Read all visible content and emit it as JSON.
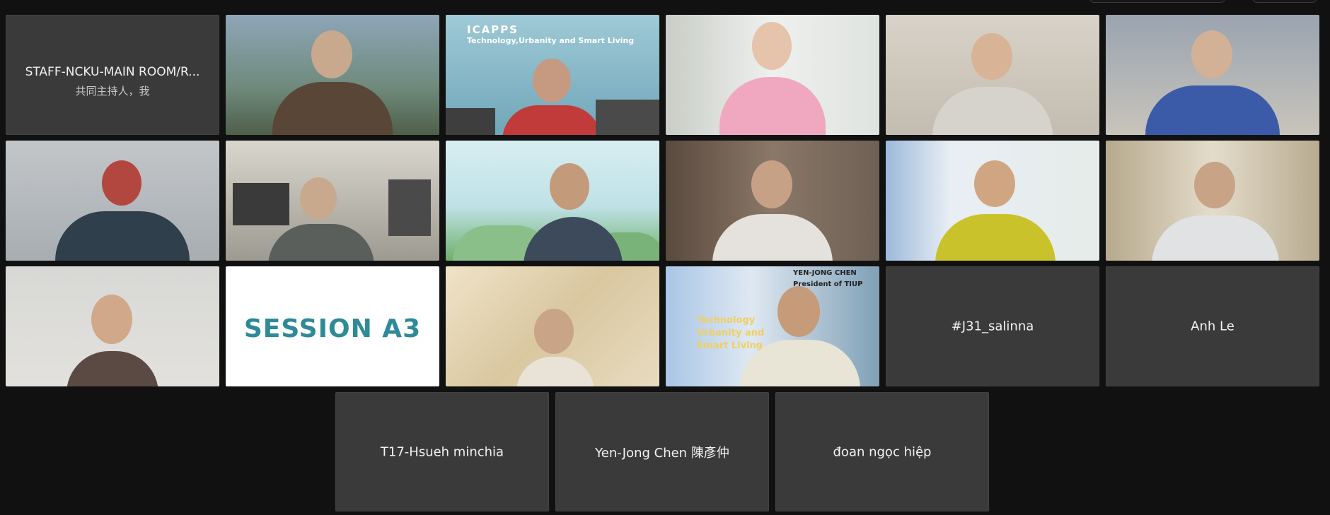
{
  "participants": {
    "row1": [
      {
        "label": "STAFF-NCKU-MAIN ROOM/R...",
        "sub": "共同主持人，我"
      },
      {
        "label": ""
      },
      {
        "label": "ICAPPS",
        "sub": "Technology,Urbanity and Smart Living"
      },
      {
        "label": ""
      },
      {
        "label": ""
      },
      {
        "label": ""
      }
    ],
    "row3": [
      {
        "label": ""
      },
      {
        "label": "SESSION A3"
      },
      {
        "label": ""
      },
      {
        "label": "YEN-JONG CHEN",
        "sub": "President of TIUP",
        "poster": "Technology\nUrbanity and\nSmart Living"
      },
      {
        "label": "#J31_salinna"
      },
      {
        "label": "Anh Le"
      }
    ],
    "row4": [
      {
        "label": "T17-Hsueh minchia"
      },
      {
        "label": "Yen-Jong Chen 陳彥仲"
      },
      {
        "label": "đoan ngọc hiệp"
      }
    ]
  },
  "colors": {
    "background": "#111111",
    "tile_gray": "#3a3a3a",
    "session_text": "#2e8a96"
  }
}
